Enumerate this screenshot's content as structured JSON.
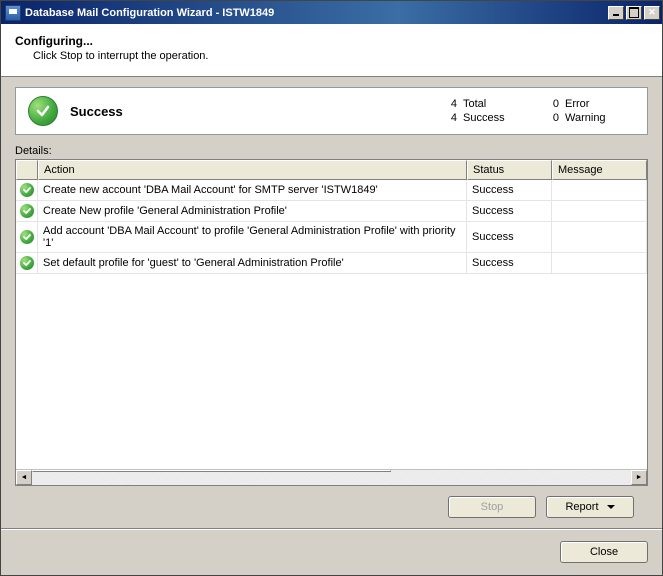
{
  "window": {
    "title": "Database Mail Configuration Wizard - ISTW1849"
  },
  "header": {
    "title": "Configuring...",
    "subtitle": "Click Stop to interrupt the operation."
  },
  "summary": {
    "label": "Success",
    "stats": {
      "total_n": "4",
      "total_l": "Total",
      "success_n": "4",
      "success_l": "Success",
      "error_n": "0",
      "error_l": "Error",
      "warning_n": "0",
      "warning_l": "Warning"
    }
  },
  "details": {
    "label": "Details:",
    "columns": {
      "action": "Action",
      "status": "Status",
      "message": "Message"
    },
    "rows": [
      {
        "action": "Create new account 'DBA Mail Account' for SMTP server 'ISTW1849'",
        "status": "Success",
        "message": ""
      },
      {
        "action": "Create New profile 'General Administration Profile'",
        "status": "Success",
        "message": ""
      },
      {
        "action": "Add account 'DBA Mail Account' to profile 'General Administration Profile' with priority '1'",
        "status": "Success",
        "message": ""
      },
      {
        "action": "Set default profile for 'guest' to 'General Administration Profile'",
        "status": "Success",
        "message": ""
      }
    ]
  },
  "buttons": {
    "stop": "Stop",
    "report": "Report",
    "close": "Close"
  }
}
